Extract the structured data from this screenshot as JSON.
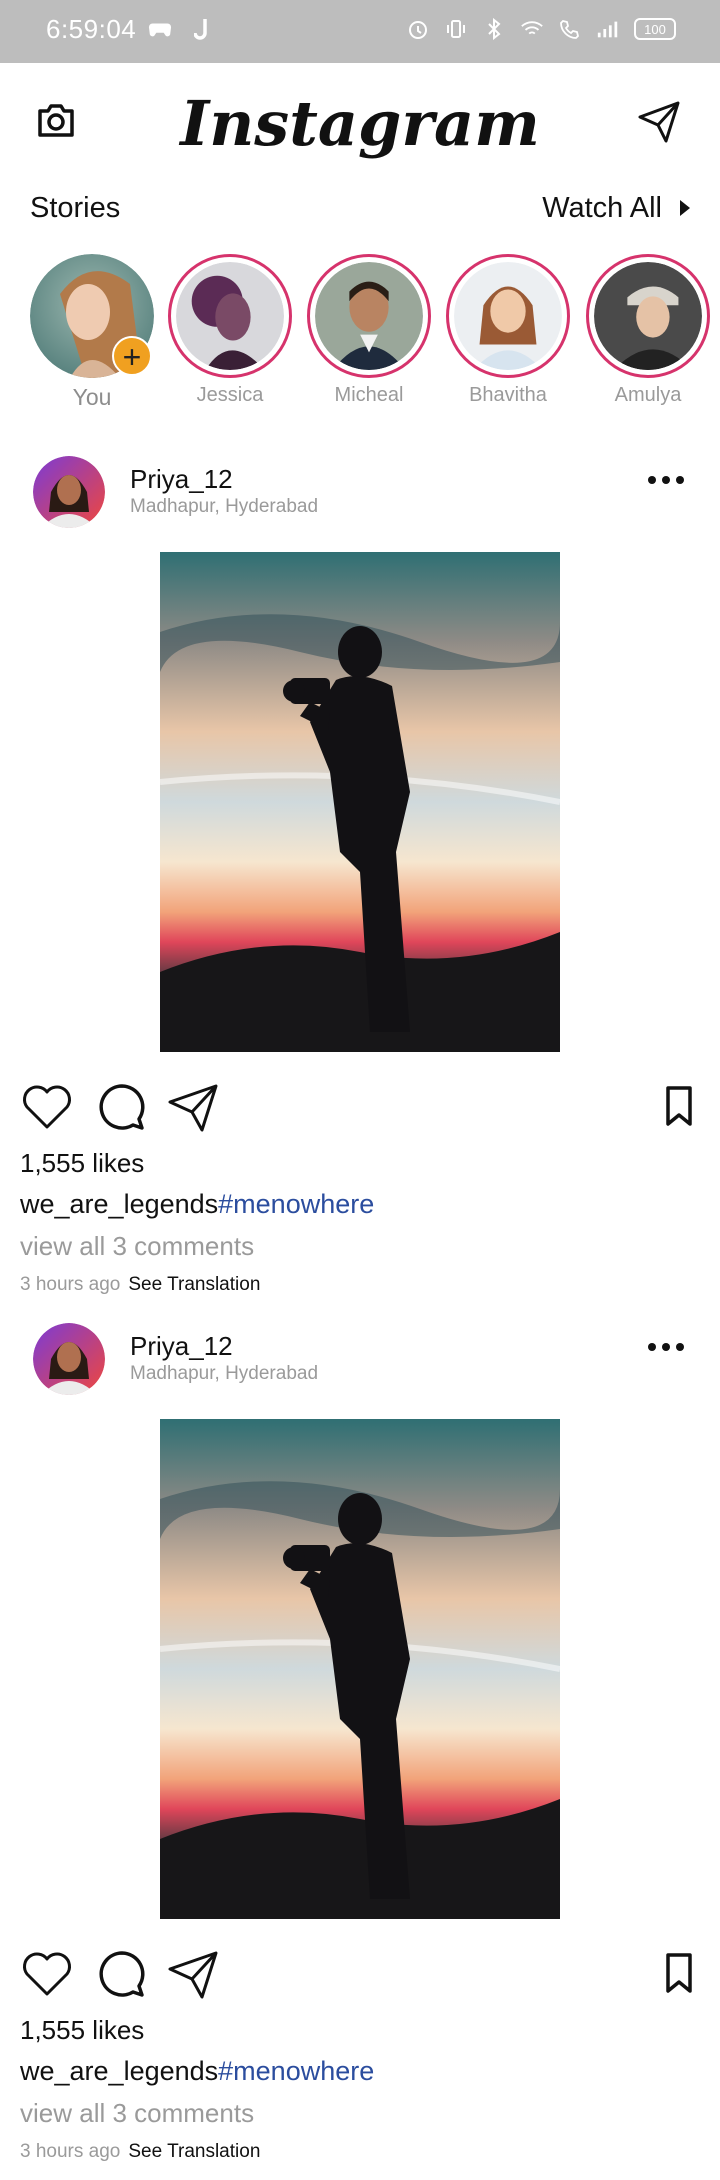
{
  "status_bar": {
    "time": "6:59:04",
    "battery": "100"
  },
  "header": {
    "logo": "Instagram"
  },
  "stories": {
    "title": "Stories",
    "watch_all": "Watch All",
    "items": [
      {
        "name": "You"
      },
      {
        "name": "Jessica"
      },
      {
        "name": "Micheal"
      },
      {
        "name": "Bhavitha"
      },
      {
        "name": "Amulya"
      }
    ]
  },
  "posts": [
    {
      "username": "Priya_12",
      "location": "Madhapur, Hyderabad",
      "likes": "1,555 likes",
      "caption_user": "we_are_legends",
      "caption_tag": "#menowhere",
      "comments": "view all 3 comments",
      "time_ago": "3 hours ago",
      "see_translation": "See Translation"
    },
    {
      "username": "Priya_12",
      "location": "Madhapur, Hyderabad",
      "likes": "1,555 likes",
      "caption_user": "we_are_legends",
      "caption_tag": "#menowhere",
      "comments": "view all 3 comments",
      "time_ago": "3 hours ago",
      "see_translation": "See Translation"
    }
  ],
  "colors": {
    "status_bar": "#bdbdbd",
    "story_ring": "#d6336c",
    "add_story": "#f0a020",
    "hashtag": "#2b4d9e"
  }
}
